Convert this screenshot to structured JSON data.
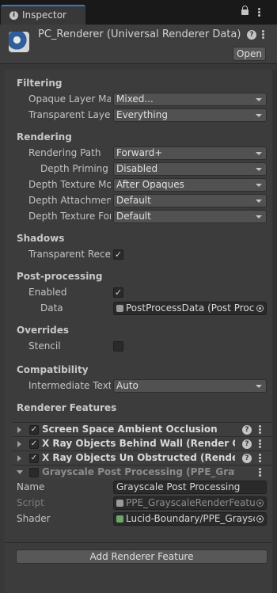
{
  "tab": {
    "title": "Inspector",
    "info_glyph": "i"
  },
  "header": {
    "title": "PC_Renderer (Universal Renderer Data)",
    "open_label": "Open",
    "help_glyph": "?"
  },
  "sections": {
    "filtering": "Filtering",
    "rendering": "Rendering",
    "shadows": "Shadows",
    "post_processing": "Post-processing",
    "overrides": "Overrides",
    "compatibility": "Compatibility",
    "renderer_features": "Renderer Features"
  },
  "fields": {
    "opaque_layer_mask": {
      "label": "Opaque Layer Mask",
      "value": "Mixed..."
    },
    "transparent_layer_mask": {
      "label": "Transparent Layer Mask",
      "value": "Everything"
    },
    "rendering_path": {
      "label": "Rendering Path",
      "value": "Forward+"
    },
    "depth_priming_mode": {
      "label": "Depth Priming Mode",
      "value": "Disabled"
    },
    "depth_texture_mode": {
      "label": "Depth Texture Mode",
      "value": "After Opaques"
    },
    "depth_attachment_format": {
      "label": "Depth Attachment Format",
      "value": "Default"
    },
    "depth_texture_format": {
      "label": "Depth Texture Format",
      "value": "Default"
    },
    "transparent_receive_shadows": {
      "label": "Transparent Receive Shadows",
      "checked": "✓"
    },
    "pp_enabled": {
      "label": "Enabled",
      "checked": "✓"
    },
    "pp_data": {
      "label": "Data",
      "value": "PostProcessData (Post Process Data)"
    },
    "stencil": {
      "label": "Stencil",
      "checked": ""
    },
    "intermediate_texture": {
      "label": "Intermediate Texture",
      "value": "Auto"
    }
  },
  "features": [
    {
      "name": "Screen Space Ambient Occlusion",
      "checked": "✓"
    },
    {
      "name": "X Ray Objects Behind Wall (Render Objects)",
      "checked": "✓"
    },
    {
      "name": "X Ray Objects Un Obstructed (Render Objects)",
      "checked": "✓"
    },
    {
      "name": "Grayscale Post Processing (PPE_GrayscaleRenderFeature)",
      "checked": ""
    }
  ],
  "grayscale": {
    "name_label": "Name",
    "name_value": "Grayscale Post Processing",
    "script_label": "Script",
    "script_value": "PPE_GrayscaleRenderFeature",
    "shader_label": "Shader",
    "shader_value": "Lucid-Boundary/PPE_Grayscale"
  },
  "add_button": "Add Renderer Feature",
  "colors": {
    "accent": "#3a79bb",
    "panel": "#383838",
    "field": "#515151"
  },
  "icons": [
    "info-icon",
    "lock-icon",
    "kebab-icon",
    "renderer-asset-icon",
    "help-icon",
    "dropdown-arrow-icon",
    "object-picker-icon",
    "foldout-arrow-icon",
    "checkbox-icon"
  ]
}
